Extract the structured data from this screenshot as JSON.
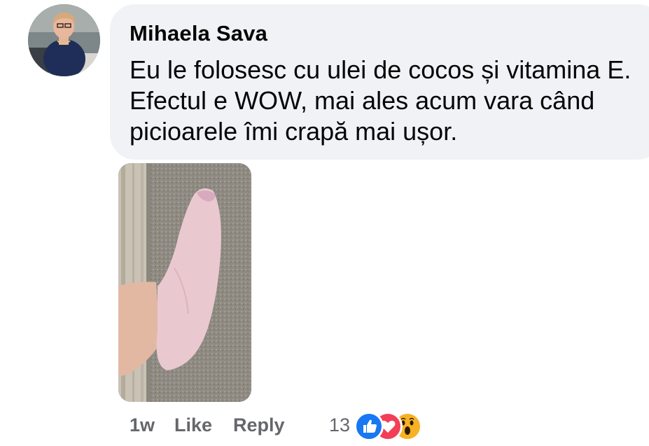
{
  "comment": {
    "author": "Mihaela Sava",
    "text": "Eu le folosesc cu ulei de cocos și vitamina E. Efectul e WOW, mai ales acum vara când picioarele îmi crapă mai ușor."
  },
  "actions": {
    "time": "1w",
    "like": "Like",
    "reply": "Reply"
  },
  "reactions": {
    "count": "13",
    "types": [
      "like-icon",
      "love-icon",
      "wow-icon"
    ],
    "colors": {
      "like": "#1877f2",
      "love": "#f33e58",
      "wow": "#f7b125"
    }
  },
  "theme": {
    "bubble_bg": "#f0f2f5",
    "text_color": "#050505",
    "secondary_text": "#65676b"
  }
}
